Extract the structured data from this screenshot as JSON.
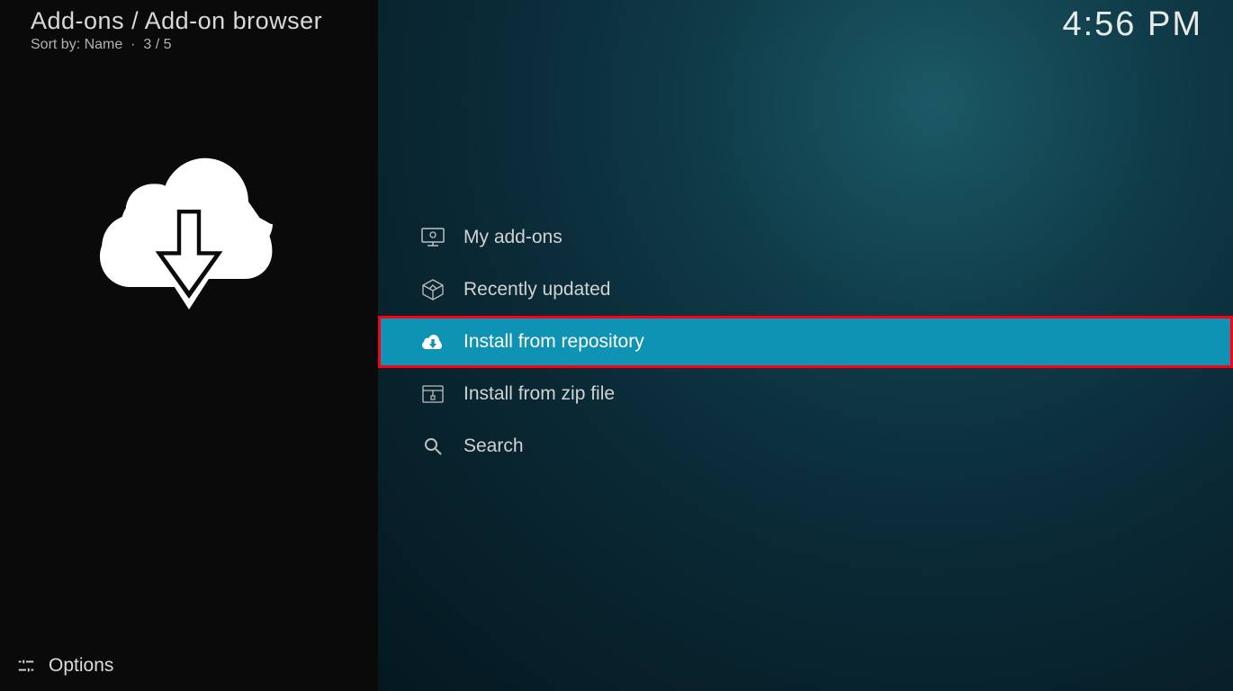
{
  "header": {
    "breadcrumb": "Add-ons / Add-on browser",
    "sort_by_label": "Sort by: Name",
    "position": "3 / 5"
  },
  "clock": "4:56 PM",
  "sidebar": {
    "options_label": "Options"
  },
  "menu": {
    "items": [
      {
        "label": "My add-ons",
        "icon": "monitor-icon",
        "selected": false
      },
      {
        "label": "Recently updated",
        "icon": "box-update-icon",
        "selected": false
      },
      {
        "label": "Install from repository",
        "icon": "cloud-download-icon",
        "selected": true
      },
      {
        "label": "Install from zip file",
        "icon": "zip-file-icon",
        "selected": false
      },
      {
        "label": "Search",
        "icon": "search-icon",
        "selected": false
      }
    ]
  },
  "highlight_item_index": 2
}
